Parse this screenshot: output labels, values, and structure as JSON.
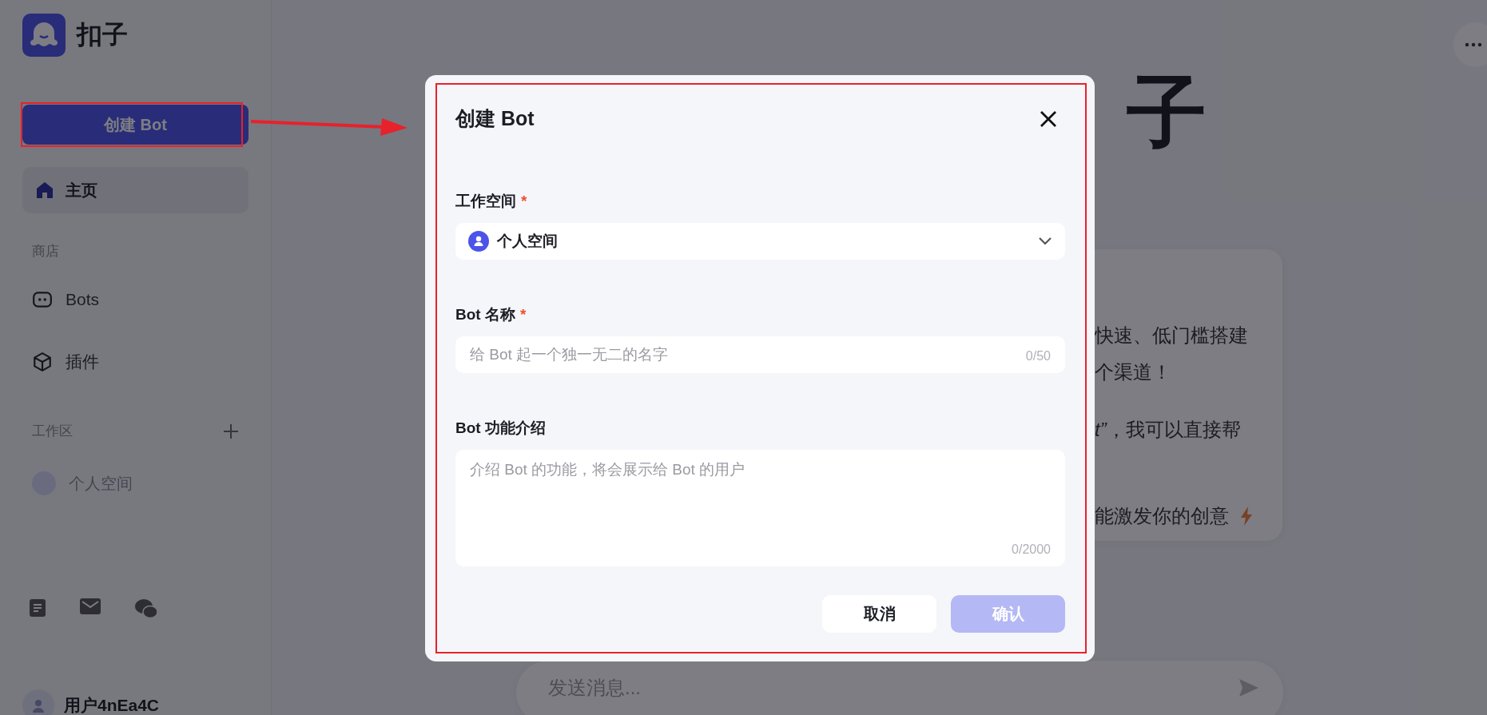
{
  "sidebar": {
    "logo_text": "扣子",
    "create_button": "创建 Bot",
    "nav": [
      {
        "label": "主页",
        "selected": true
      }
    ],
    "store_heading": "商店",
    "store_items": [
      {
        "kind": "bot",
        "label": "Bots"
      },
      {
        "kind": "plugin",
        "label": "插件"
      }
    ],
    "workspace_heading": "工作区",
    "workspaces": [
      {
        "label": "个人空间"
      }
    ],
    "user": "用户4nEa4C"
  },
  "main": {
    "title": "子",
    "card_lines": [
      "快速、低门槛搭建",
      "个渠道！",
      "*t”*，我可以直接帮",
      "能激发你的创意"
    ],
    "chat_placeholder": "发送消息..."
  },
  "dialog": {
    "title": "创建 Bot",
    "fields": [
      {
        "kind": "select",
        "label": "工作空间",
        "required": true,
        "value": "个人空间"
      },
      {
        "kind": "input",
        "label": "Bot 名称",
        "required": true,
        "placeholder": "给 Bot 起一个独一无二的名字",
        "counter": "0/50"
      },
      {
        "kind": "textarea",
        "label": "Bot 功能介绍",
        "required": false,
        "placeholder": "介绍 Bot 的功能，将会展示给 Bot 的用户",
        "counter": "0/2000"
      }
    ],
    "required_mark": "*",
    "cancel": "取消",
    "confirm": {
      "label": "确认",
      "disabled": true
    }
  }
}
